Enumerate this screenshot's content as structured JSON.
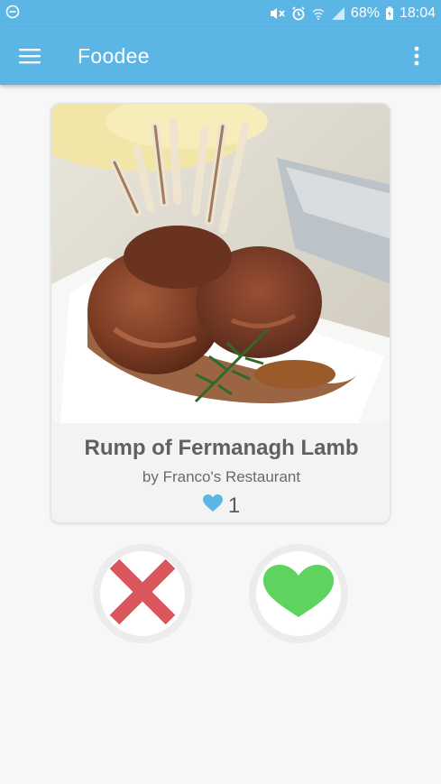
{
  "statusbar": {
    "battery": "68%",
    "time": "18:04"
  },
  "appbar": {
    "title": "Foodee",
    "menu_icon": "hamburger-menu-icon",
    "more_icon": "more-vert-icon"
  },
  "card": {
    "title": "Rump of Fermanagh Lamb",
    "subtitle": "by Franco's Restaurant",
    "likes": "1"
  },
  "colors": {
    "primary": "#5bb6e6",
    "reject": "#d9565b",
    "like": "#5fd35f",
    "like_icon": "#5bb6e6"
  }
}
